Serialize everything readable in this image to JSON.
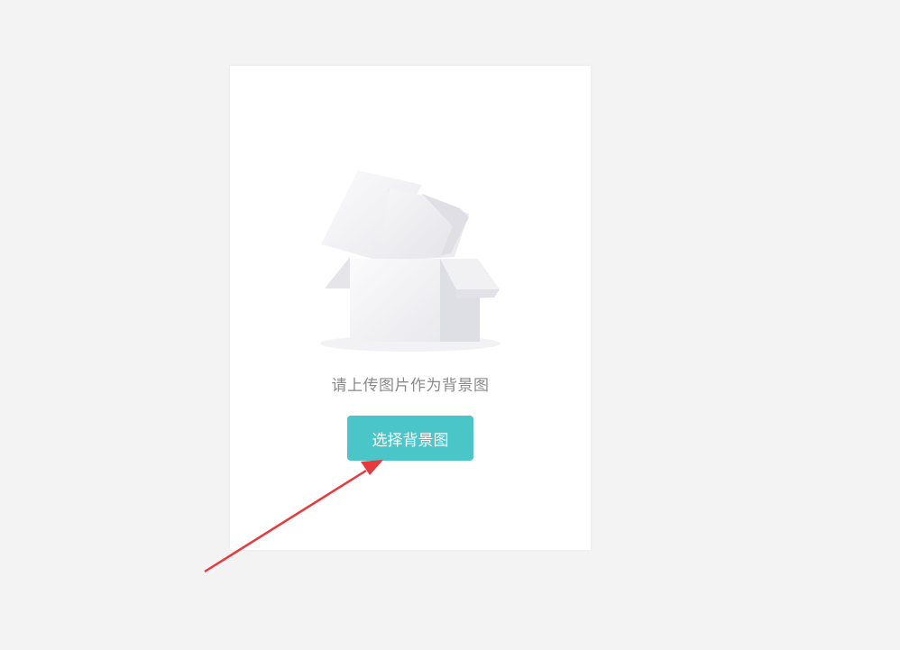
{
  "empty_state": {
    "message": "请上传图片作为背景图",
    "button_label": "选择背景图",
    "illustration": "open-box-icon"
  },
  "colors": {
    "page_background": "#f3f3f3",
    "card_background": "#ffffff",
    "button_background": "#4ac5c8",
    "button_text": "#ffffff",
    "message_text": "#8a8a8a",
    "annotation_arrow": "#e8393b"
  },
  "annotation": {
    "type": "arrow",
    "target": "select-background-button"
  }
}
